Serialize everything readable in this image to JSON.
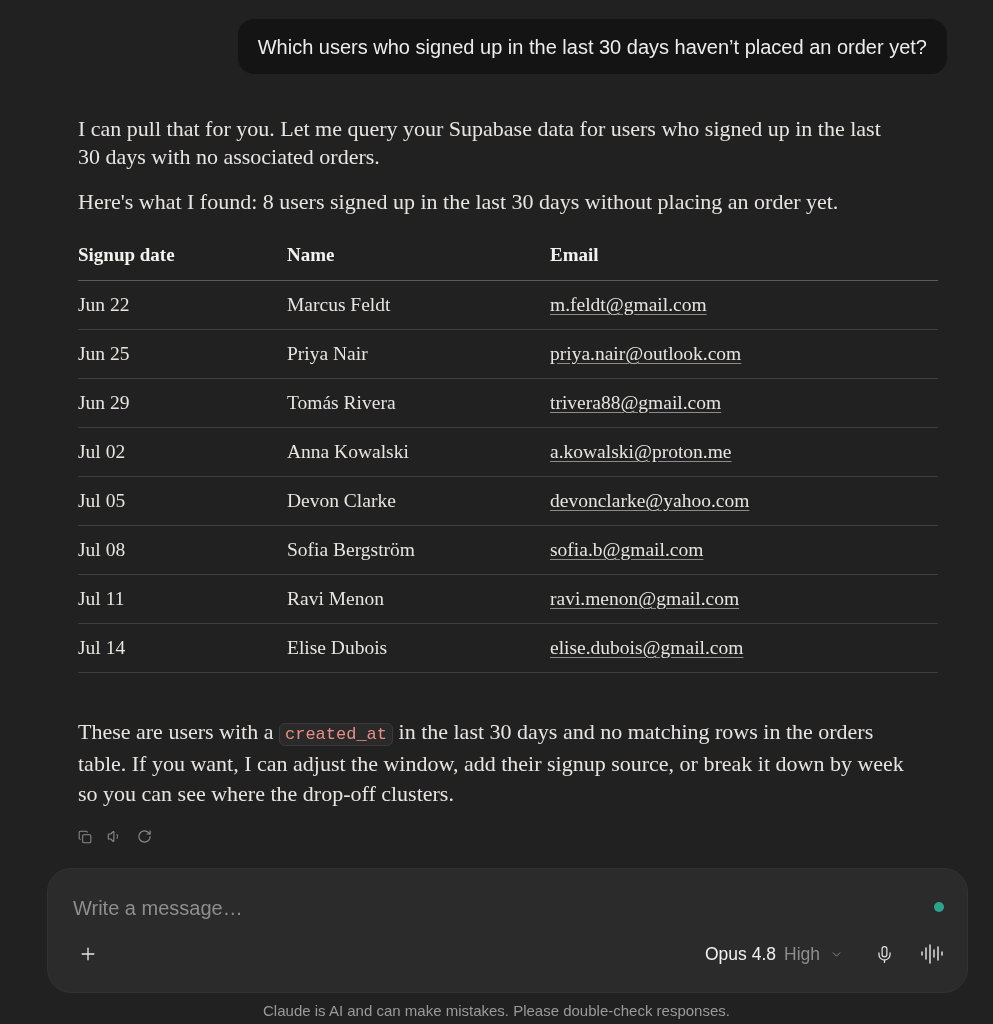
{
  "user_message": {
    "text": "Which users who signed up in the last 30 days haven’t placed an order yet?"
  },
  "assistant_message": {
    "intro": [
      "I can pull that for you. Let me query your Supabase data for users who signed up in the last 30 days with no associated orders.",
      "Here's what I found: 8 users signed up in the last 30 days without placing an order yet."
    ],
    "table": {
      "columns": [
        "Signup date",
        "Name",
        "Email"
      ],
      "rows": [
        {
          "signup_date": "Jun 22",
          "name": "Marcus Feldt",
          "email": "m.feldt@gmail.com"
        },
        {
          "signup_date": "Jun 25",
          "name": "Priya Nair",
          "email": "priya.nair@outlook.com"
        },
        {
          "signup_date": "Jun 29",
          "name": "Tomás Rivera",
          "email": "trivera88@gmail.com"
        },
        {
          "signup_date": "Jul 02",
          "name": "Anna Kowalski",
          "email": "a.kowalski@proton.me"
        },
        {
          "signup_date": "Jul 05",
          "name": "Devon Clarke",
          "email": "devonclarke@yahoo.com"
        },
        {
          "signup_date": "Jul 08",
          "name": "Sofia Bergström",
          "email": "sofia.b@gmail.com"
        },
        {
          "signup_date": "Jul 11",
          "name": "Ravi Menon",
          "email": "ravi.menon@gmail.com"
        },
        {
          "signup_date": "Jul 14",
          "name": "Elise Dubois",
          "email": "elise.dubois@gmail.com"
        }
      ]
    },
    "closing": [
      {
        "kind": "text",
        "text": "These are users with a "
      },
      {
        "kind": "code",
        "text": "created_at"
      },
      {
        "kind": "text",
        "text": " in the last 30 days and no matching rows in the orders table. If you want, I can adjust the window, add their signup source, or break it down by week so you can see where the drop-off clusters."
      }
    ]
  },
  "composer": {
    "placeholder": "Write a message…",
    "model": "Opus 4.8",
    "effort": "High"
  },
  "footer": {
    "text": "Claude is AI and can make mistakes. Please double-check responses."
  }
}
